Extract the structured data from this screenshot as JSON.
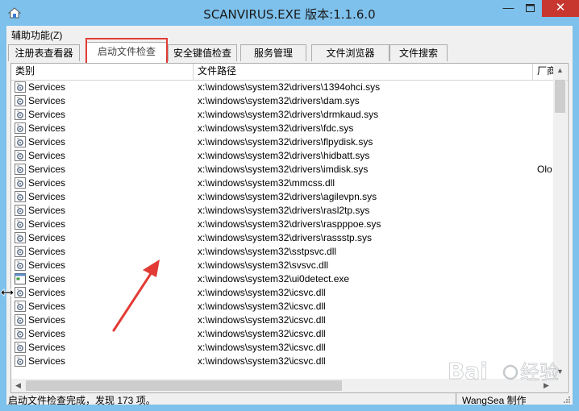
{
  "window": {
    "title": "SCANVIRUS.EXE  版本:1.1.6.0",
    "min_glyph": "—",
    "close_glyph": "✕"
  },
  "menu": {
    "assist": "辅助功能(Z)"
  },
  "tabs": [
    {
      "label": "注册表查看器"
    },
    {
      "label": "启动文件检查",
      "active": true
    },
    {
      "label": "安全键值检查"
    },
    {
      "label": "服务管理"
    },
    {
      "label": "文件浏览器"
    },
    {
      "label": "文件搜索"
    }
  ],
  "columns": {
    "category": "类别",
    "path": "文件路径",
    "vendor": "厂商"
  },
  "rows": [
    {
      "category": "Services",
      "path": "x:\\windows\\system32\\drivers\\1394ohci.sys",
      "vendor": "",
      "icon": "service-icon"
    },
    {
      "category": "Services",
      "path": "x:\\windows\\system32\\drivers\\dam.sys",
      "vendor": "",
      "icon": "service-icon"
    },
    {
      "category": "Services",
      "path": "x:\\windows\\system32\\drivers\\drmkaud.sys",
      "vendor": "",
      "icon": "service-icon"
    },
    {
      "category": "Services",
      "path": "x:\\windows\\system32\\drivers\\fdc.sys",
      "vendor": "",
      "icon": "service-icon"
    },
    {
      "category": "Services",
      "path": "x:\\windows\\system32\\drivers\\flpydisk.sys",
      "vendor": "",
      "icon": "service-icon"
    },
    {
      "category": "Services",
      "path": "x:\\windows\\system32\\drivers\\hidbatt.sys",
      "vendor": "",
      "icon": "service-icon"
    },
    {
      "category": "Services",
      "path": "x:\\windows\\system32\\drivers\\imdisk.sys",
      "vendor": "Olo",
      "icon": "service-icon"
    },
    {
      "category": "Services",
      "path": "x:\\windows\\system32\\mmcss.dll",
      "vendor": "",
      "icon": "service-icon"
    },
    {
      "category": "Services",
      "path": "x:\\windows\\system32\\drivers\\agilevpn.sys",
      "vendor": "",
      "icon": "service-icon"
    },
    {
      "category": "Services",
      "path": "x:\\windows\\system32\\drivers\\rasl2tp.sys",
      "vendor": "",
      "icon": "service-icon"
    },
    {
      "category": "Services",
      "path": "x:\\windows\\system32\\drivers\\raspppoe.sys",
      "vendor": "",
      "icon": "service-icon"
    },
    {
      "category": "Services",
      "path": "x:\\windows\\system32\\drivers\\rassstp.sys",
      "vendor": "",
      "icon": "service-icon"
    },
    {
      "category": "Services",
      "path": "x:\\windows\\system32\\sstpsvc.dll",
      "vendor": "",
      "icon": "service-icon"
    },
    {
      "category": "Services",
      "path": "x:\\windows\\system32\\svsvc.dll",
      "vendor": "",
      "icon": "service-icon"
    },
    {
      "category": "Services",
      "path": "x:\\windows\\system32\\ui0detect.exe",
      "vendor": "",
      "icon": "application-icon"
    },
    {
      "category": "Services",
      "path": "x:\\windows\\system32\\icsvc.dll",
      "vendor": "",
      "icon": "service-icon"
    },
    {
      "category": "Services",
      "path": "x:\\windows\\system32\\icsvc.dll",
      "vendor": "",
      "icon": "service-icon"
    },
    {
      "category": "Services",
      "path": "x:\\windows\\system32\\icsvc.dll",
      "vendor": "",
      "icon": "service-icon"
    },
    {
      "category": "Services",
      "path": "x:\\windows\\system32\\icsvc.dll",
      "vendor": "",
      "icon": "service-icon"
    },
    {
      "category": "Services",
      "path": "x:\\windows\\system32\\icsvc.dll",
      "vendor": "",
      "icon": "service-icon"
    },
    {
      "category": "Services",
      "path": "x:\\windows\\system32\\icsvc.dll",
      "vendor": "",
      "icon": "service-icon"
    }
  ],
  "status": {
    "message": "启动文件检查完成，发现 173 项。",
    "author": "WangSea 制作"
  },
  "colors": {
    "title_bar": "#7ec1ec",
    "close_button": "#c7372f",
    "annotation": "#e23b36"
  }
}
